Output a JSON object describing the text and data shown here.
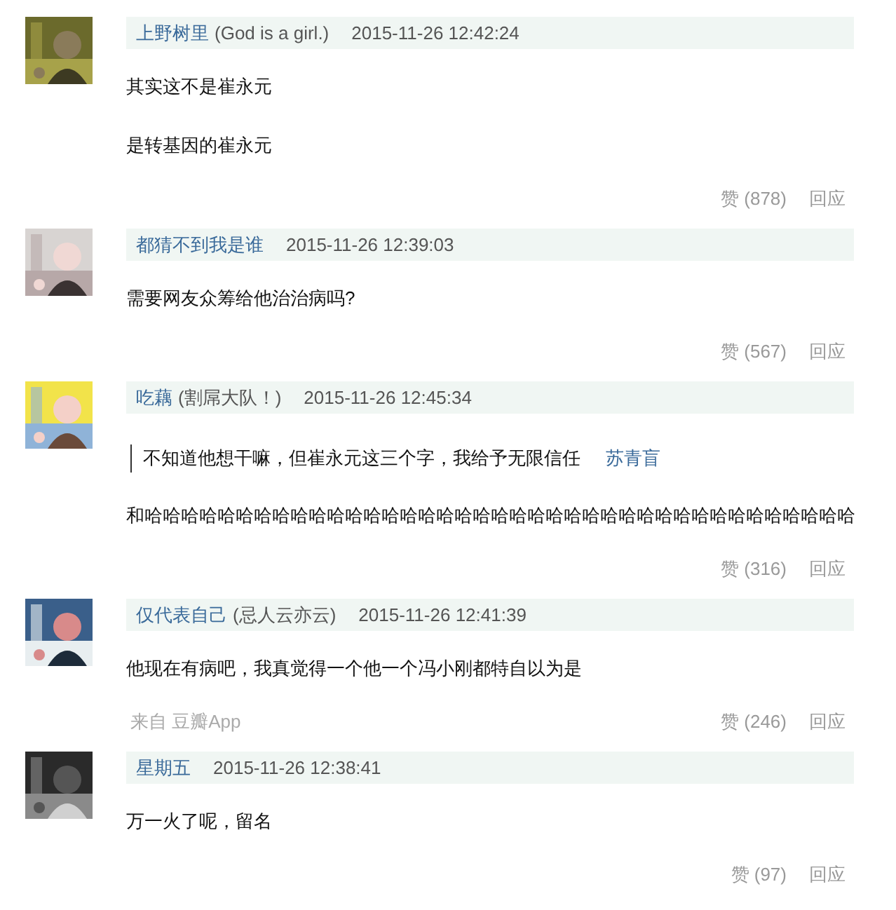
{
  "comments": [
    {
      "user": "上野树里",
      "alias": "(God is a girl.)",
      "time": "2015-11-26 12:42:24",
      "body": [
        {
          "kind": "text",
          "text": "其实这不是崔永元"
        },
        {
          "kind": "text",
          "text": "是转基因的崔永元"
        }
      ],
      "likes": "赞 (878)",
      "reply": "回应"
    },
    {
      "user": "都猜不到我是谁",
      "time": "2015-11-26 12:39:03",
      "body": [
        {
          "kind": "text",
          "text": "需要网友众筹给他治治病吗?"
        }
      ],
      "likes": "赞 (567)",
      "reply": "回应"
    },
    {
      "user": "吃藕",
      "alias": "(割屌大队！)",
      "time": "2015-11-26 12:45:34",
      "body": [
        {
          "kind": "quote",
          "text": "不知道他想干嘛，但崔永元这三个字，我给予无限信任",
          "author": "苏青盲"
        },
        {
          "kind": "text",
          "text": "和哈哈哈哈哈哈哈哈哈哈哈哈哈哈哈哈哈哈哈哈哈哈哈哈哈哈哈哈哈哈哈哈哈哈哈哈哈哈哈"
        }
      ],
      "likes": "赞 (316)",
      "reply": "回应"
    },
    {
      "user": "仅代表自己",
      "alias": "(忌人云亦云)",
      "time": "2015-11-26 12:41:39",
      "body": [
        {
          "kind": "text",
          "text": "他现在有病吧，我真觉得一个他一个冯小刚都特自以为是"
        }
      ],
      "source": "来自 豆瓣App",
      "likes": "赞 (246)",
      "reply": "回应"
    },
    {
      "user": "星期五",
      "time": "2015-11-26 12:38:41",
      "body": [
        {
          "kind": "text",
          "text": "万一火了呢，留名"
        }
      ],
      "likes": "赞 (97)",
      "reply": "回应"
    }
  ]
}
